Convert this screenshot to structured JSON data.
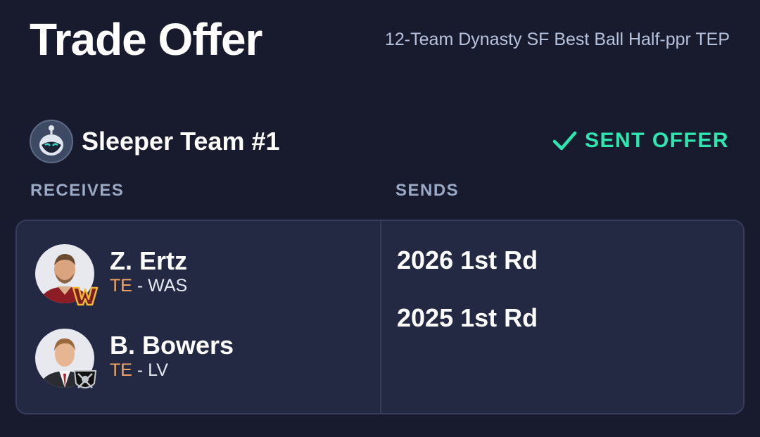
{
  "header": {
    "title": "Trade Offer",
    "league": "12-Team Dynasty SF Best Ball Half-ppr TEP"
  },
  "team": {
    "name": "Sleeper Team #1",
    "avatar_icon": "sleeper-mascot-icon",
    "status": "SENT OFFER",
    "status_icon": "checkmark-icon",
    "status_color": "#2ee6b0"
  },
  "columns": {
    "receives": "RECEIVES",
    "sends": "SENDS"
  },
  "receives": [
    {
      "name": "Z. Ertz",
      "position": "TE",
      "separator": " - ",
      "team": "WAS",
      "team_logo": "commanders-logo"
    },
    {
      "name": "B. Bowers",
      "position": "TE",
      "separator": " - ",
      "team": "LV",
      "team_logo": "raiders-logo"
    }
  ],
  "sends": [
    {
      "label": "2026 1st Rd"
    },
    {
      "label": "2025 1st Rd"
    }
  ],
  "colors": {
    "background": "#181a2d",
    "card": "#242943",
    "position": "#f3a866"
  }
}
